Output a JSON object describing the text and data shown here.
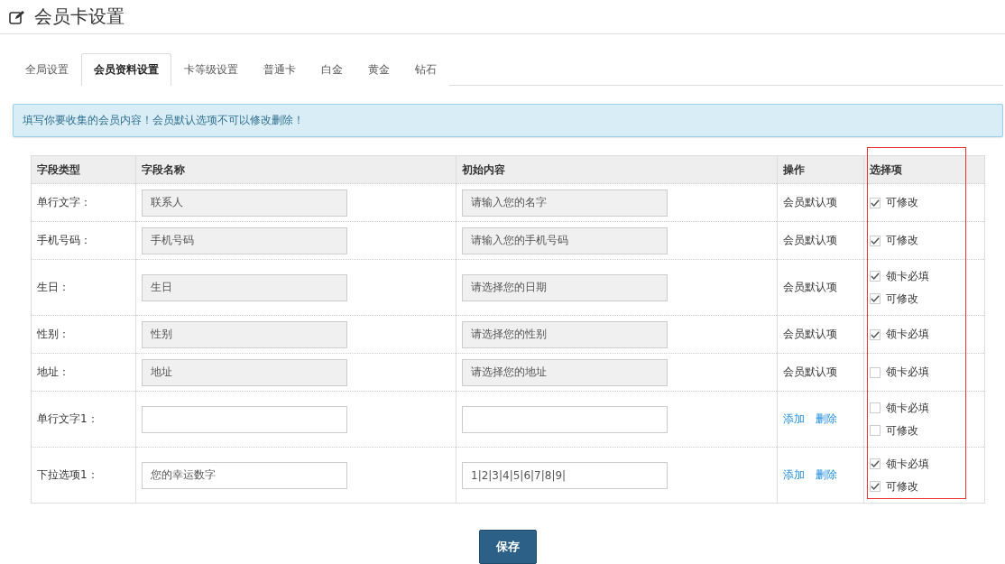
{
  "page": {
    "title": "会员卡设置"
  },
  "tabs": [
    {
      "label": "全局设置",
      "selected": false
    },
    {
      "label": "会员资料设置",
      "selected": true
    },
    {
      "label": "卡等级设置",
      "selected": false
    },
    {
      "label": "普通卡",
      "selected": false
    },
    {
      "label": "白金",
      "selected": false
    },
    {
      "label": "黄金",
      "selected": false
    },
    {
      "label": "钻石",
      "selected": false
    }
  ],
  "notice": "填写你要收集的会员内容！会员默认选项不可以修改删除！",
  "table": {
    "columns": [
      "字段类型",
      "字段名称",
      "初始内容",
      "操作",
      "选择项"
    ],
    "rows": [
      {
        "kind": "default",
        "type": "单行文字：",
        "name": "联系人",
        "initial": "请输入您的名字",
        "disabled": true,
        "operation": "会员默认项",
        "options": [
          {
            "label": "可修改",
            "checked": true
          }
        ]
      },
      {
        "kind": "default",
        "type": "手机号码：",
        "name": "手机号码",
        "initial": "请输入您的手机号码",
        "disabled": true,
        "operation": "会员默认项",
        "options": [
          {
            "label": "可修改",
            "checked": true
          }
        ]
      },
      {
        "kind": "default",
        "type": "生日：",
        "name": "生日",
        "initial": "请选择您的日期",
        "disabled": true,
        "operation": "会员默认项",
        "options": [
          {
            "label": "领卡必填",
            "checked": true
          },
          {
            "label": "可修改",
            "checked": true
          }
        ]
      },
      {
        "kind": "default",
        "type": "性别：",
        "name": "性别",
        "initial": "请选择您的性别",
        "disabled": true,
        "operation": "会员默认项",
        "options": [
          {
            "label": "领卡必填",
            "checked": true
          }
        ]
      },
      {
        "kind": "default",
        "type": "地址：",
        "name": "地址",
        "initial": "请选择您的地址",
        "disabled": true,
        "operation": "会员默认项",
        "options": [
          {
            "label": "领卡必填",
            "checked": false
          }
        ]
      },
      {
        "kind": "custom",
        "type": "单行文字1：",
        "disabled": false,
        "actions": [
          "添加",
          "删除"
        ],
        "options": [
          {
            "label": "领卡必填",
            "checked": false
          },
          {
            "label": "可修改",
            "checked": false
          }
        ]
      },
      {
        "kind": "custom",
        "type": "下拉选项1：",
        "name": "您的幸运数字",
        "initial": "1|2|3|4|5|6|7|8|9|",
        "disabled": false,
        "actions": [
          "添加",
          "删除"
        ],
        "options": [
          {
            "label": "领卡必填",
            "checked": true
          },
          {
            "label": "可修改",
            "checked": true
          }
        ]
      }
    ]
  },
  "save_button": "保存"
}
